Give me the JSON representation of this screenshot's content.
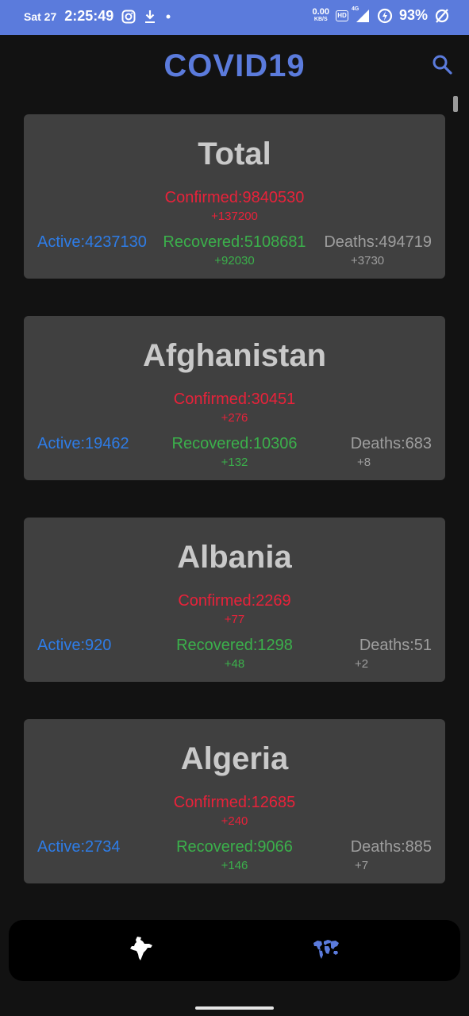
{
  "status_bar": {
    "date": "Sat 27",
    "time": "2:25:49",
    "net_speed": "0.00",
    "net_unit": "KB/S",
    "hd_label": "HD",
    "signal_label": "4G",
    "battery": "93%"
  },
  "app_bar": {
    "title": "COVID19"
  },
  "colors": {
    "accent": "#5B7BDC",
    "confirmed": "#E8223A",
    "active": "#2E7CE6",
    "recovered": "#3BB04B",
    "deaths": "#9E9E9E",
    "card_bg": "#404040",
    "page_bg": "#121212"
  },
  "cards": [
    {
      "name": "Total",
      "confirmed": "Confirmed:9840530",
      "confirmed_delta": "+137200",
      "active": "Active:4237130",
      "recovered": "Recovered:5108681",
      "recovered_delta": "+92030",
      "deaths": "Deaths:494719",
      "deaths_delta": "+3730"
    },
    {
      "name": "Afghanistan",
      "confirmed": "Confirmed:30451",
      "confirmed_delta": "+276",
      "active": "Active:19462",
      "recovered": "Recovered:10306",
      "recovered_delta": "+132",
      "deaths": "Deaths:683",
      "deaths_delta": "+8"
    },
    {
      "name": "Albania",
      "confirmed": "Confirmed:2269",
      "confirmed_delta": "+77",
      "active": "Active:920",
      "recovered": "Recovered:1298",
      "recovered_delta": "+48",
      "deaths": "Deaths:51",
      "deaths_delta": "+2"
    },
    {
      "name": "Algeria",
      "confirmed": "Confirmed:12685",
      "confirmed_delta": "+240",
      "active": "Active:2734",
      "recovered": "Recovered:9066",
      "recovered_delta": "+146",
      "deaths": "Deaths:885",
      "deaths_delta": "+7"
    }
  ],
  "bottom_nav": {
    "items": [
      {
        "icon": "india-map-icon"
      },
      {
        "icon": "world-map-icon"
      }
    ]
  }
}
